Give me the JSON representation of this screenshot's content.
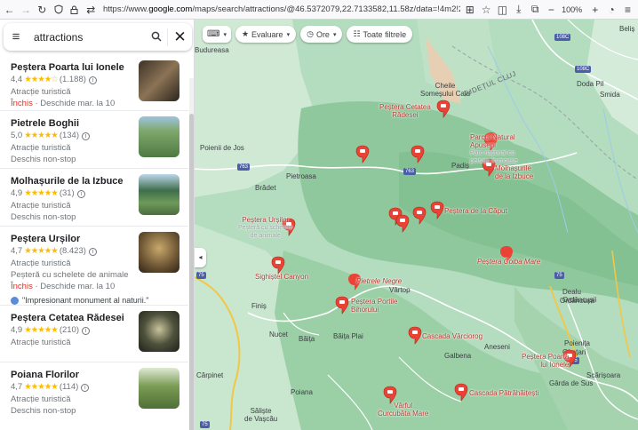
{
  "browser": {
    "url_prefix": "https://www.",
    "url_domain": "google.com",
    "url_rest": "/maps/search/attractions/@46.5372079,22.7133582,11.58z/data=!4m2!2m1!6e1!5m1!1e1",
    "zoom": "100%"
  },
  "search": {
    "query": "attractions"
  },
  "results": [
    {
      "title": "Peștera Poarta lui Ionele",
      "rating": "4,4",
      "stars": "★★★★☆",
      "reviews": "(1.188)",
      "category": "Atracție turistică",
      "status_closed": "Închis",
      "status_rest": " · Deschide mar. la 10",
      "status_type": "closed",
      "thumb_color": "#6b5a47"
    },
    {
      "title": "Pietrele Boghii",
      "rating": "5,0",
      "stars": "★★★★★",
      "reviews": "(134)",
      "category": "Atracție turistică",
      "status_open": "Deschis non-stop",
      "status_type": "open",
      "thumb_color": "#5d8c57"
    },
    {
      "title": "Molhașurile de la Izbuce",
      "rating": "4,9",
      "stars": "★★★★★",
      "reviews": "(31)",
      "category": "Atracție turistică",
      "status_open": "Deschis non-stop",
      "status_type": "open",
      "thumb_color": "#4f7f6a"
    },
    {
      "title": "Peștera Urșilor",
      "rating": "4,7",
      "stars": "★★★★★",
      "reviews": "(8.423)",
      "category": "Atracție turistică",
      "desc": "Peșteră cu schelete de animale",
      "status_closed": "Închis",
      "status_rest": " · Deschide mar. la 10",
      "status_type": "closed",
      "review": "\"Impresionant monument al naturii.\"",
      "thumb_color": "#8c7a5a"
    },
    {
      "title": "Peștera Cetatea Rădesei",
      "rating": "4,9",
      "stars": "★★★★★",
      "reviews": "(210)",
      "category": "Atracție turistică",
      "status_type": "none",
      "thumb_color": "#5a5f4a"
    },
    {
      "title": "Poiana Florilor",
      "rating": "4,7",
      "stars": "★★★★★",
      "reviews": "(114)",
      "category": "Atracție turistică",
      "status_open": "Deschis non-stop",
      "status_type": "open",
      "thumb_color": "#6c8f4c"
    }
  ],
  "filters": {
    "rating": "Evaluare",
    "hours": "Ore",
    "all": "Toate filtrele"
  },
  "map": {
    "places": [
      {
        "name": "Cheile\nSomeșului Cald",
        "kind": "label"
      },
      {
        "name": "JUDEȚUL CLUJ",
        "kind": "label"
      },
      {
        "name": "Peștera Cetatea\nRădesei",
        "kind": "poi"
      },
      {
        "name": "Parcul Natural\nApuseni",
        "sub": "Parc național cu\npeisaje frumoase",
        "kind": "poi"
      },
      {
        "name": "Molhașurile\nde la Izbuce",
        "kind": "poi"
      },
      {
        "name": "Poienii de Jos",
        "kind": "label"
      },
      {
        "name": "Pietroasa",
        "kind": "label"
      },
      {
        "name": "Brădet",
        "kind": "label"
      },
      {
        "name": "Padiș",
        "kind": "label"
      },
      {
        "name": "Peștera Urșilor",
        "sub": "Peșteră cu schelete\nde animale",
        "kind": "poi"
      },
      {
        "name": "Peștera de la Căput",
        "kind": "poi"
      },
      {
        "name": "Peștera Coiba Mare",
        "kind": "poi"
      },
      {
        "name": "Sighiștel Canyon",
        "kind": "poi"
      },
      {
        "name": "Pietrele Negre",
        "kind": "poi"
      },
      {
        "name": "Vârtop",
        "kind": "label"
      },
      {
        "name": "Peștera Portile\nBihorului",
        "kind": "poi"
      },
      {
        "name": "Finiș",
        "kind": "label"
      },
      {
        "name": "Nucet",
        "kind": "label"
      },
      {
        "name": "Băița",
        "kind": "label"
      },
      {
        "name": "Băița Plai",
        "kind": "label"
      },
      {
        "name": "Cascada Vârciorog",
        "kind": "poi"
      },
      {
        "name": "Galbena",
        "kind": "label"
      },
      {
        "name": "Aneseni",
        "kind": "label"
      },
      {
        "name": "Peștera Poarta\nlui Ionele",
        "kind": "poi"
      },
      {
        "name": "Cărpinet",
        "kind": "label"
      },
      {
        "name": "Poiana",
        "kind": "label"
      },
      {
        "name": "Vârful\nCurcubăta Mare",
        "kind": "poi"
      },
      {
        "name": "Cascada Pătrăhăițești",
        "kind": "poi"
      },
      {
        "name": "Săliște\nde Vașcău",
        "kind": "label"
      },
      {
        "name": "Gârda de Sus",
        "kind": "label"
      },
      {
        "name": "Scărișoara",
        "kind": "label"
      },
      {
        "name": "Ghețari",
        "kind": "label"
      },
      {
        "name": "Poienița",
        "kind": "label"
      },
      {
        "name": "Ordâncușa",
        "kind": "label"
      },
      {
        "name": "Dealu\nOrdâncușii",
        "kind": "label"
      },
      {
        "name": "Budureasa",
        "kind": "label"
      },
      {
        "name": "Doda Pil",
        "kind": "label"
      },
      {
        "name": "Smida",
        "kind": "label"
      },
      {
        "name": "Beliș",
        "kind": "label"
      }
    ],
    "roads": [
      "763",
      "763",
      "108C",
      "108C",
      "75",
      "75",
      "75",
      "75"
    ]
  }
}
